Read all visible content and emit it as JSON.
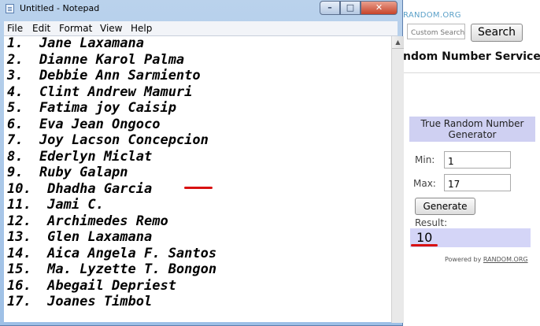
{
  "webpage": {
    "logo_text": "RANDOM.ORG",
    "search_placeholder": "Custom Search",
    "search_button": "Search",
    "service_heading": "ndom Number Service",
    "widget": {
      "header": "True Random Number Generator",
      "min_label": "Min:",
      "min_value": "1",
      "max_label": "Max:",
      "max_value": "17",
      "generate_button": "Generate",
      "result_label": "Result:",
      "result_value": "10",
      "powered_by_prefix": "Powered by ",
      "powered_by_link": "RANDOM.ORG"
    }
  },
  "notepad": {
    "title": "Untitled - Notepad",
    "menu": [
      "File",
      "Edit",
      "Format",
      "View",
      "Help"
    ],
    "controls": {
      "minimize": "–",
      "maximize": "□",
      "close": "✕"
    },
    "lines": [
      "1.  Jane Laxamana",
      "2.  Dianne Karol Palma",
      "3.  Debbie Ann Sarmiento",
      "4.  Clint Andrew Mamuri",
      "5.  Fatima joy Caisip",
      "6.  Eva Jean Ongoco",
      "7.  Joy Lacson Concepcion",
      "8.  Ederlyn Miclat",
      "9.  Ruby Galapn",
      "10.  Dhadha Garcia",
      "11.  Jami C.",
      "12.  Archimedes Remo",
      "13.  Glen Laxamana",
      "14.  Aica Angela F. Santos",
      "15.  Ma. Lyzette T. Bongon",
      "16.  Abegail Depriest",
      "17.  Joanes Timbol"
    ]
  },
  "annotation_color": "#d81212"
}
